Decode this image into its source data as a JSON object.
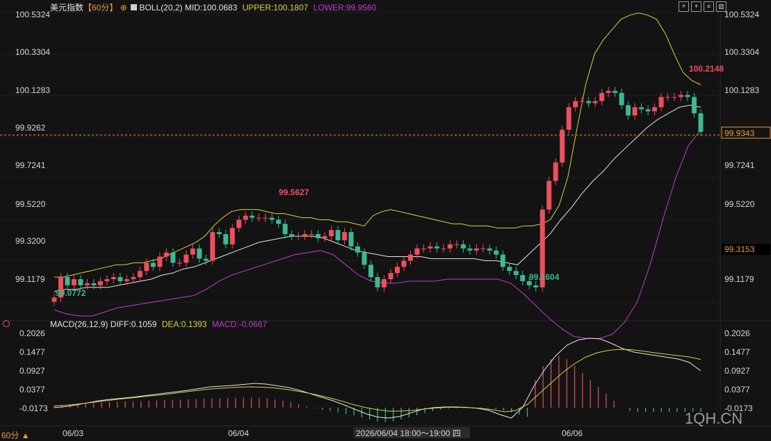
{
  "header": {
    "symbol": "美元指数",
    "period_tag": "【60分】",
    "boll_label": "BOLL(20,2)",
    "mid_label": "MID:100.0683",
    "upper_label": "UPPER:100.1807",
    "lower_label": "LOWER:99.9560",
    "macd_label": "MACD(26,12,9)",
    "diff_label": "DIFF:0.1059",
    "dea_label": "DEA:0.1393",
    "macd_value_label": "MACD:-0.0667"
  },
  "footer": {
    "period": "60分",
    "watermark": "1QH.CN",
    "cursor_time": "2026/06/04 18:00～19:00 四"
  },
  "price_axis": {
    "ticks": [
      "100.5324",
      "100.3304",
      "100.1283",
      "99.9262",
      "99.7241",
      "99.5220",
      "99.3200",
      "99.1179"
    ],
    "current_price": "99.9343",
    "cursor_price": "99.3153"
  },
  "macd_axis": {
    "ticks": [
      "0.2026",
      "0.1477",
      "0.0927",
      "0.0377",
      "-0.0173"
    ]
  },
  "x_axis": {
    "labels": [
      "06/03",
      "06/04",
      "06/06"
    ]
  },
  "annotations": {
    "max_label": "100.2148",
    "local_high_label": "99.5627",
    "local_low_label": "99.1604",
    "min_label": "99.0772"
  },
  "colors": {
    "up": "#ef4f5d",
    "down": "#3cb991",
    "upper": "#d7d24a",
    "mid": "#e6e6e6",
    "lower": "#c43ad0",
    "diff": "#e6e6e6",
    "dea": "#d7d24a",
    "price_line": "#e89c3a"
  },
  "chart_data": {
    "type": "candlestick",
    "price_range": [
      99.05,
      100.56
    ],
    "close": [
      99.14,
      99.24,
      99.2,
      99.23,
      99.2,
      99.21,
      99.2,
      99.22,
      99.23,
      99.24,
      99.22,
      99.23,
      99.24,
      99.27,
      99.31,
      99.29,
      99.34,
      99.36,
      99.31,
      99.31,
      99.35,
      99.38,
      99.33,
      99.32,
      99.46,
      99.45,
      99.4,
      99.48,
      99.52,
      99.54,
      99.53,
      99.53,
      99.53,
      99.52,
      99.5,
      99.45,
      99.44,
      99.44,
      99.45,
      99.45,
      99.43,
      99.44,
      99.47,
      99.42,
      99.46,
      99.39,
      99.36,
      99.3,
      99.24,
      99.19,
      99.23,
      99.26,
      99.29,
      99.32,
      99.35,
      99.38,
      99.38,
      99.39,
      99.38,
      99.38,
      99.4,
      99.4,
      99.38,
      99.37,
      99.38,
      99.38,
      99.37,
      99.35,
      99.29,
      99.27,
      99.25,
      99.22,
      99.2,
      99.19,
      99.57,
      99.71,
      99.8,
      99.96,
      100.07,
      100.1,
      100.1,
      100.09,
      100.1,
      100.14,
      100.15,
      100.14,
      100.08,
      100.03,
      100.07,
      100.06,
      100.05,
      100.07,
      100.12,
      100.12,
      100.12,
      100.13,
      100.12,
      100.04,
      99.95
    ],
    "boll_upper": [
      99.24,
      99.24,
      99.25,
      99.26,
      99.27,
      99.28,
      99.29,
      99.3,
      99.3,
      99.31,
      99.31,
      99.32,
      99.33,
      99.35,
      99.37,
      99.39,
      99.41,
      99.44,
      99.49,
      99.53,
      99.56,
      99.57,
      99.57,
      99.57,
      99.56,
      99.55,
      99.55,
      99.54,
      99.53,
      99.53,
      99.52,
      99.52,
      99.51,
      99.51,
      99.5,
      99.49,
      99.54,
      99.56,
      99.57,
      99.56,
      99.55,
      99.54,
      99.53,
      99.52,
      99.51,
      99.5,
      99.5,
      99.49,
      99.49,
      99.49,
      99.48,
      99.48,
      99.48,
      99.49,
      99.49,
      99.5,
      99.52,
      99.59,
      99.73,
      99.96,
      100.18,
      100.33,
      100.4,
      100.45,
      100.5,
      100.52,
      100.53,
      100.52,
      100.5,
      100.43,
      100.33,
      100.24,
      100.2,
      100.18
    ],
    "boll_mid": [
      99.17,
      99.18,
      99.18,
      99.19,
      99.19,
      99.19,
      99.2,
      99.21,
      99.22,
      99.23,
      99.25,
      99.26,
      99.28,
      99.29,
      99.31,
      99.33,
      99.35,
      99.37,
      99.39,
      99.41,
      99.42,
      99.43,
      99.44,
      99.44,
      99.44,
      99.43,
      99.41,
      99.39,
      99.37,
      99.36,
      99.35,
      99.34,
      99.34,
      99.34,
      99.34,
      99.33,
      99.33,
      99.33,
      99.33,
      99.33,
      99.32,
      99.32,
      99.31,
      99.3,
      99.35,
      99.4,
      99.45,
      99.52,
      99.58,
      99.65,
      99.71,
      99.76,
      99.82,
      99.87,
      99.92,
      99.97,
      100.01,
      100.04,
      100.07,
      100.08,
      100.07
    ],
    "boll_lower": [
      99.08,
      99.06,
      99.05,
      99.05,
      99.07,
      99.09,
      99.1,
      99.11,
      99.12,
      99.13,
      99.14,
      99.15,
      99.18,
      99.22,
      99.25,
      99.27,
      99.29,
      99.31,
      99.33,
      99.35,
      99.36,
      99.37,
      99.35,
      99.3,
      99.25,
      99.22,
      99.21,
      99.21,
      99.22,
      99.22,
      99.22,
      99.23,
      99.23,
      99.23,
      99.23,
      99.23,
      99.21,
      99.16,
      99.1,
      99.04,
      98.99,
      98.95,
      98.94,
      98.94,
      98.96,
      99.02,
      99.12,
      99.3,
      99.52,
      99.72,
      99.88,
      99.96
    ],
    "macd_range": [
      -0.05,
      0.23
    ],
    "macd_hist": [
      0.004,
      0.006,
      0.008,
      0.01,
      0.012,
      0.014,
      0.015,
      0.016,
      0.017,
      0.018,
      0.018,
      0.019,
      0.02,
      0.021,
      0.022,
      0.022,
      0.023,
      0.024,
      0.025,
      0.026,
      0.027,
      0.027,
      0.028,
      0.028,
      0.029,
      0.029,
      0.028,
      0.027,
      0.024,
      0.02,
      0.016,
      0.01,
      0.004,
      -0.002,
      -0.006,
      -0.01,
      -0.014,
      -0.018,
      -0.022,
      -0.028,
      -0.034,
      -0.04,
      -0.042,
      -0.04,
      -0.034,
      -0.028,
      -0.022,
      -0.016,
      -0.01,
      -0.006,
      -0.003,
      -0.002,
      -0.001,
      0.0,
      -0.001,
      -0.002,
      -0.004,
      -0.008,
      -0.014,
      -0.02,
      -0.026,
      0.08,
      0.12,
      0.14,
      0.15,
      0.14,
      0.12,
      0.1,
      0.08,
      0.06,
      0.04,
      0.02,
      0.0,
      -0.01,
      -0.012,
      -0.012,
      -0.012,
      -0.012,
      -0.012,
      -0.012,
      -0.012,
      -0.012,
      -0.012
    ],
    "diff": [
      0.0,
      0.003,
      0.008,
      0.014,
      0.02,
      0.024,
      0.027,
      0.03,
      0.034,
      0.038,
      0.042,
      0.046,
      0.05,
      0.055,
      0.06,
      0.062,
      0.064,
      0.067,
      0.07,
      0.068,
      0.063,
      0.058,
      0.05,
      0.04,
      0.03,
      0.02,
      0.008,
      -0.005,
      -0.018,
      -0.027,
      -0.03,
      -0.025,
      -0.015,
      -0.005,
      0.0,
      0.002,
      0.002,
      0.001,
      -0.002,
      -0.008,
      -0.02,
      -0.03,
      0.0,
      0.06,
      0.11,
      0.15,
      0.18,
      0.195,
      0.2,
      0.198,
      0.185,
      0.17,
      0.16,
      0.155,
      0.15,
      0.145,
      0.14,
      0.13,
      0.106
    ],
    "dea": [
      0.005,
      0.007,
      0.01,
      0.014,
      0.018,
      0.022,
      0.026,
      0.029,
      0.033,
      0.036,
      0.04,
      0.044,
      0.048,
      0.052,
      0.055,
      0.057,
      0.059,
      0.06,
      0.059,
      0.057,
      0.053,
      0.048,
      0.042,
      0.035,
      0.027,
      0.018,
      0.008,
      0.0,
      -0.006,
      -0.01,
      -0.01,
      -0.008,
      -0.004,
      -0.001,
      0.001,
      0.001,
      0.0,
      -0.002,
      -0.006,
      -0.012,
      -0.008,
      0.01,
      0.04,
      0.07,
      0.1,
      0.125,
      0.145,
      0.158,
      0.165,
      0.168,
      0.167,
      0.163,
      0.158,
      0.154,
      0.15,
      0.146,
      0.139
    ]
  }
}
